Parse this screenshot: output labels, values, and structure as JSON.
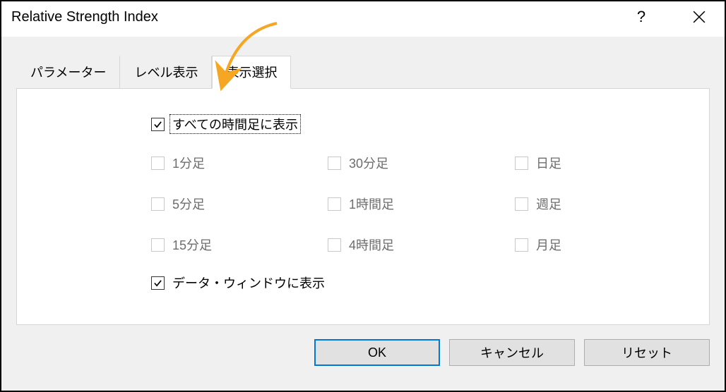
{
  "titlebar": {
    "title": "Relative Strength Index"
  },
  "tabs": {
    "t0": "パラメーター",
    "t1": "レベル表示",
    "t2": "表示選択"
  },
  "checkboxes": {
    "show_all_timeframes": "すべての時間足に表示",
    "show_data_window": "データ・ウィンドウに表示"
  },
  "timeframes": {
    "m1": "1分足",
    "m30": "30分足",
    "d1": "日足",
    "m5": "5分足",
    "h1": "1時間足",
    "w1": "週足",
    "m15": "15分足",
    "h4": "4時間足",
    "mn1": "月足"
  },
  "buttons": {
    "ok": "OK",
    "cancel": "キャンセル",
    "reset": "リセット"
  }
}
